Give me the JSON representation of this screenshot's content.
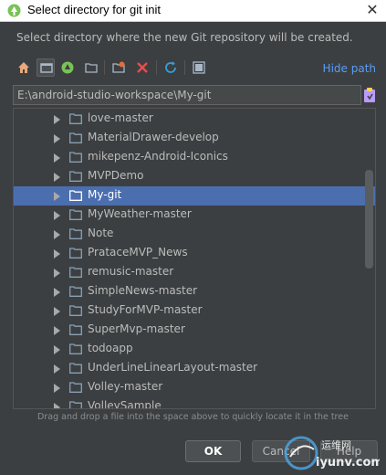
{
  "window": {
    "title": "Select directory for git init",
    "close_glyph": "✕"
  },
  "description": "Select directory where the new Git repository will be created.",
  "toolbar": {
    "icons": [
      "home-icon",
      "desktop-icon",
      "android-icon",
      "new-folder-icon",
      "new-folder-special-icon",
      "delete-icon",
      "refresh-icon",
      "show-hidden-icon"
    ],
    "hide_path_label": "Hide path"
  },
  "path": {
    "value": "E:\\android-studio-workspace\\My-git"
  },
  "tree": {
    "items": [
      {
        "label": "love-master",
        "selected": false
      },
      {
        "label": "MaterialDrawer-develop",
        "selected": false
      },
      {
        "label": "mikepenz-Android-Iconics",
        "selected": false
      },
      {
        "label": "MVPDemo",
        "selected": false
      },
      {
        "label": "My-git",
        "selected": true
      },
      {
        "label": "MyWeather-master",
        "selected": false
      },
      {
        "label": "Note",
        "selected": false
      },
      {
        "label": "PrataceMVP_News",
        "selected": false
      },
      {
        "label": "remusic-master",
        "selected": false
      },
      {
        "label": "SimpleNews-master",
        "selected": false
      },
      {
        "label": "StudyForMVP-master",
        "selected": false
      },
      {
        "label": "SuperMvp-master",
        "selected": false
      },
      {
        "label": "todoapp",
        "selected": false
      },
      {
        "label": "UnderLineLinearLayout-master",
        "selected": false
      },
      {
        "label": "Volley-master",
        "selected": false
      },
      {
        "label": "VolleySample",
        "selected": false
      }
    ]
  },
  "hint": "Drag and drop a file into the space above to quickly locate it in the tree",
  "buttons": {
    "ok": "OK",
    "cancel": "Cancel",
    "help": "Help"
  },
  "watermark": {
    "top": "运维网",
    "bottom": "iyunv.com"
  },
  "colors": {
    "background": "#3c3f41",
    "selection": "#4b6eaf",
    "link": "#589df6",
    "folder": "#87a0b7"
  }
}
